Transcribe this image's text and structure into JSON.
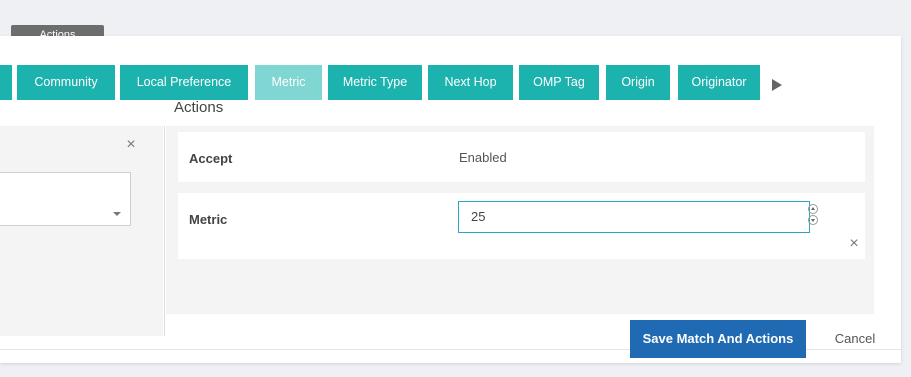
{
  "header": {
    "tab_label": "Actions"
  },
  "tabs": [
    {
      "label": "Community",
      "active": false
    },
    {
      "label": "Local Preference",
      "active": false
    },
    {
      "label": "Metric",
      "active": true
    },
    {
      "label": "Metric Type",
      "active": false
    },
    {
      "label": "Next Hop",
      "active": false
    },
    {
      "label": "OMP Tag",
      "active": false
    },
    {
      "label": "Origin",
      "active": false
    },
    {
      "label": "Originator",
      "active": false
    }
  ],
  "actions_panel": {
    "title": "Actions",
    "accept": {
      "label": "Accept",
      "value": "Enabled"
    },
    "metric": {
      "label": "Metric",
      "value": "25"
    }
  },
  "footer": {
    "save_label": "Save Match And Actions",
    "cancel_label": "Cancel"
  },
  "colors": {
    "tab": "#1cb3ae",
    "tab_active": "#7fd6d2",
    "primary_button": "#1f6ab2",
    "input_focus_border": "#27a9c4"
  },
  "icons": {
    "next": "triangle-right-icon",
    "close": "close-icon",
    "caret": "chevron-down-icon",
    "spinner": "number-spinner-icon"
  }
}
